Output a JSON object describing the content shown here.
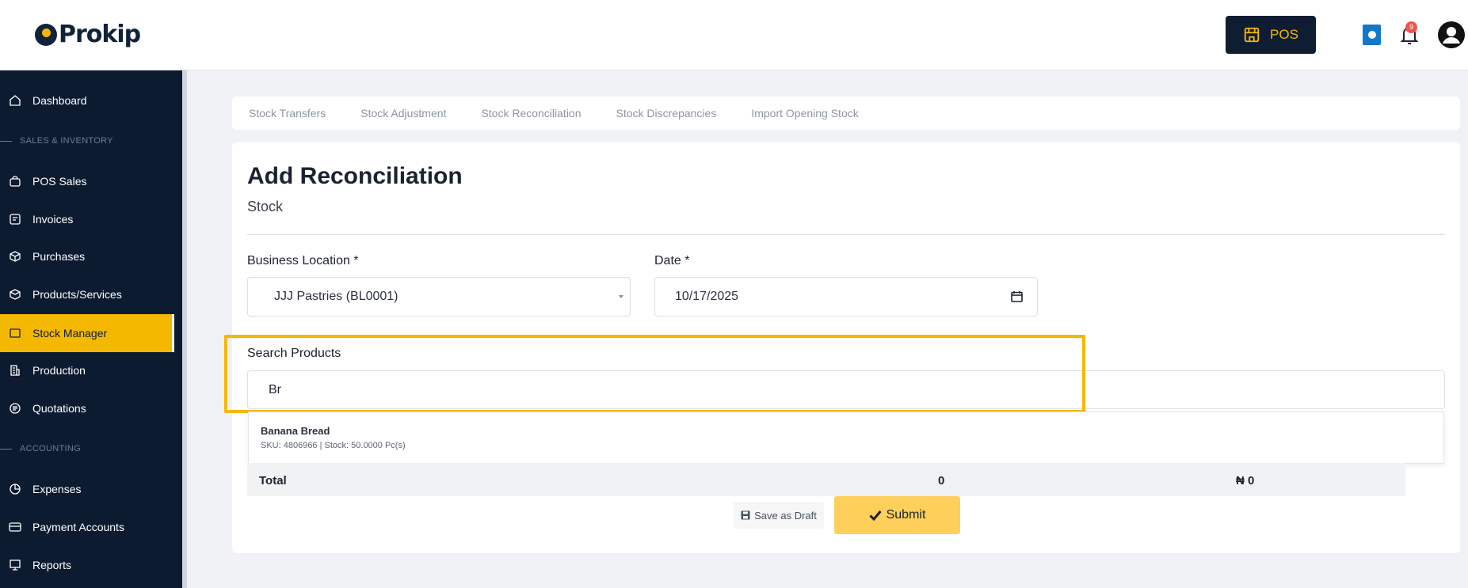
{
  "brand": {
    "logo_text": "Prokip"
  },
  "header": {
    "pos_label": "POS",
    "notification_count": "9"
  },
  "sidebar": {
    "items": [
      {
        "label": "Dashboard",
        "icon": "home-icon"
      },
      {
        "section": "SALES & INVENTORY"
      },
      {
        "label": "POS Sales",
        "icon": "bag-icon"
      },
      {
        "label": "Invoices",
        "icon": "invoice-icon"
      },
      {
        "label": "Purchases",
        "icon": "box-icon"
      },
      {
        "label": "Products/Services",
        "icon": "cube-icon"
      },
      {
        "label": "Stock Manager",
        "icon": "folder-icon",
        "active": true
      },
      {
        "label": "Production",
        "icon": "building-icon"
      },
      {
        "label": "Quotations",
        "icon": "list-icon"
      },
      {
        "section": "ACCOUNTING"
      },
      {
        "label": "Expenses",
        "icon": "pie-icon"
      },
      {
        "label": "Payment Accounts",
        "icon": "card-icon"
      },
      {
        "label": "Reports",
        "icon": "presentation-icon"
      }
    ]
  },
  "tabs": [
    {
      "label": "Stock Transfers"
    },
    {
      "label": "Stock Adjustment"
    },
    {
      "label": "Stock Reconciliation"
    },
    {
      "label": "Stock Discrepancies"
    },
    {
      "label": "Import Opening Stock"
    }
  ],
  "form": {
    "title": "Add Reconciliation",
    "subtitle": "Stock",
    "location_label": "Business Location *",
    "location_value": "JJJ Pastries (BL0001)",
    "date_label": "Date *",
    "date_value": "10/17/2025",
    "search_label": "Search Products",
    "search_value": "Br"
  },
  "suggestions": [
    {
      "name": "Banana Bread",
      "meta": "SKU: 4806966 | Stock: 50.0000 Pc(s)"
    }
  ],
  "totals": {
    "label": "Total",
    "quantity": "0",
    "amount": "₦ 0"
  },
  "actions": {
    "draft_label": "Save as Draft",
    "submit_label": "Submit"
  },
  "colors": {
    "accent": "#f5b800",
    "sidebar_bg": "#0d1b31",
    "submit_bg": "#fecf5a"
  }
}
